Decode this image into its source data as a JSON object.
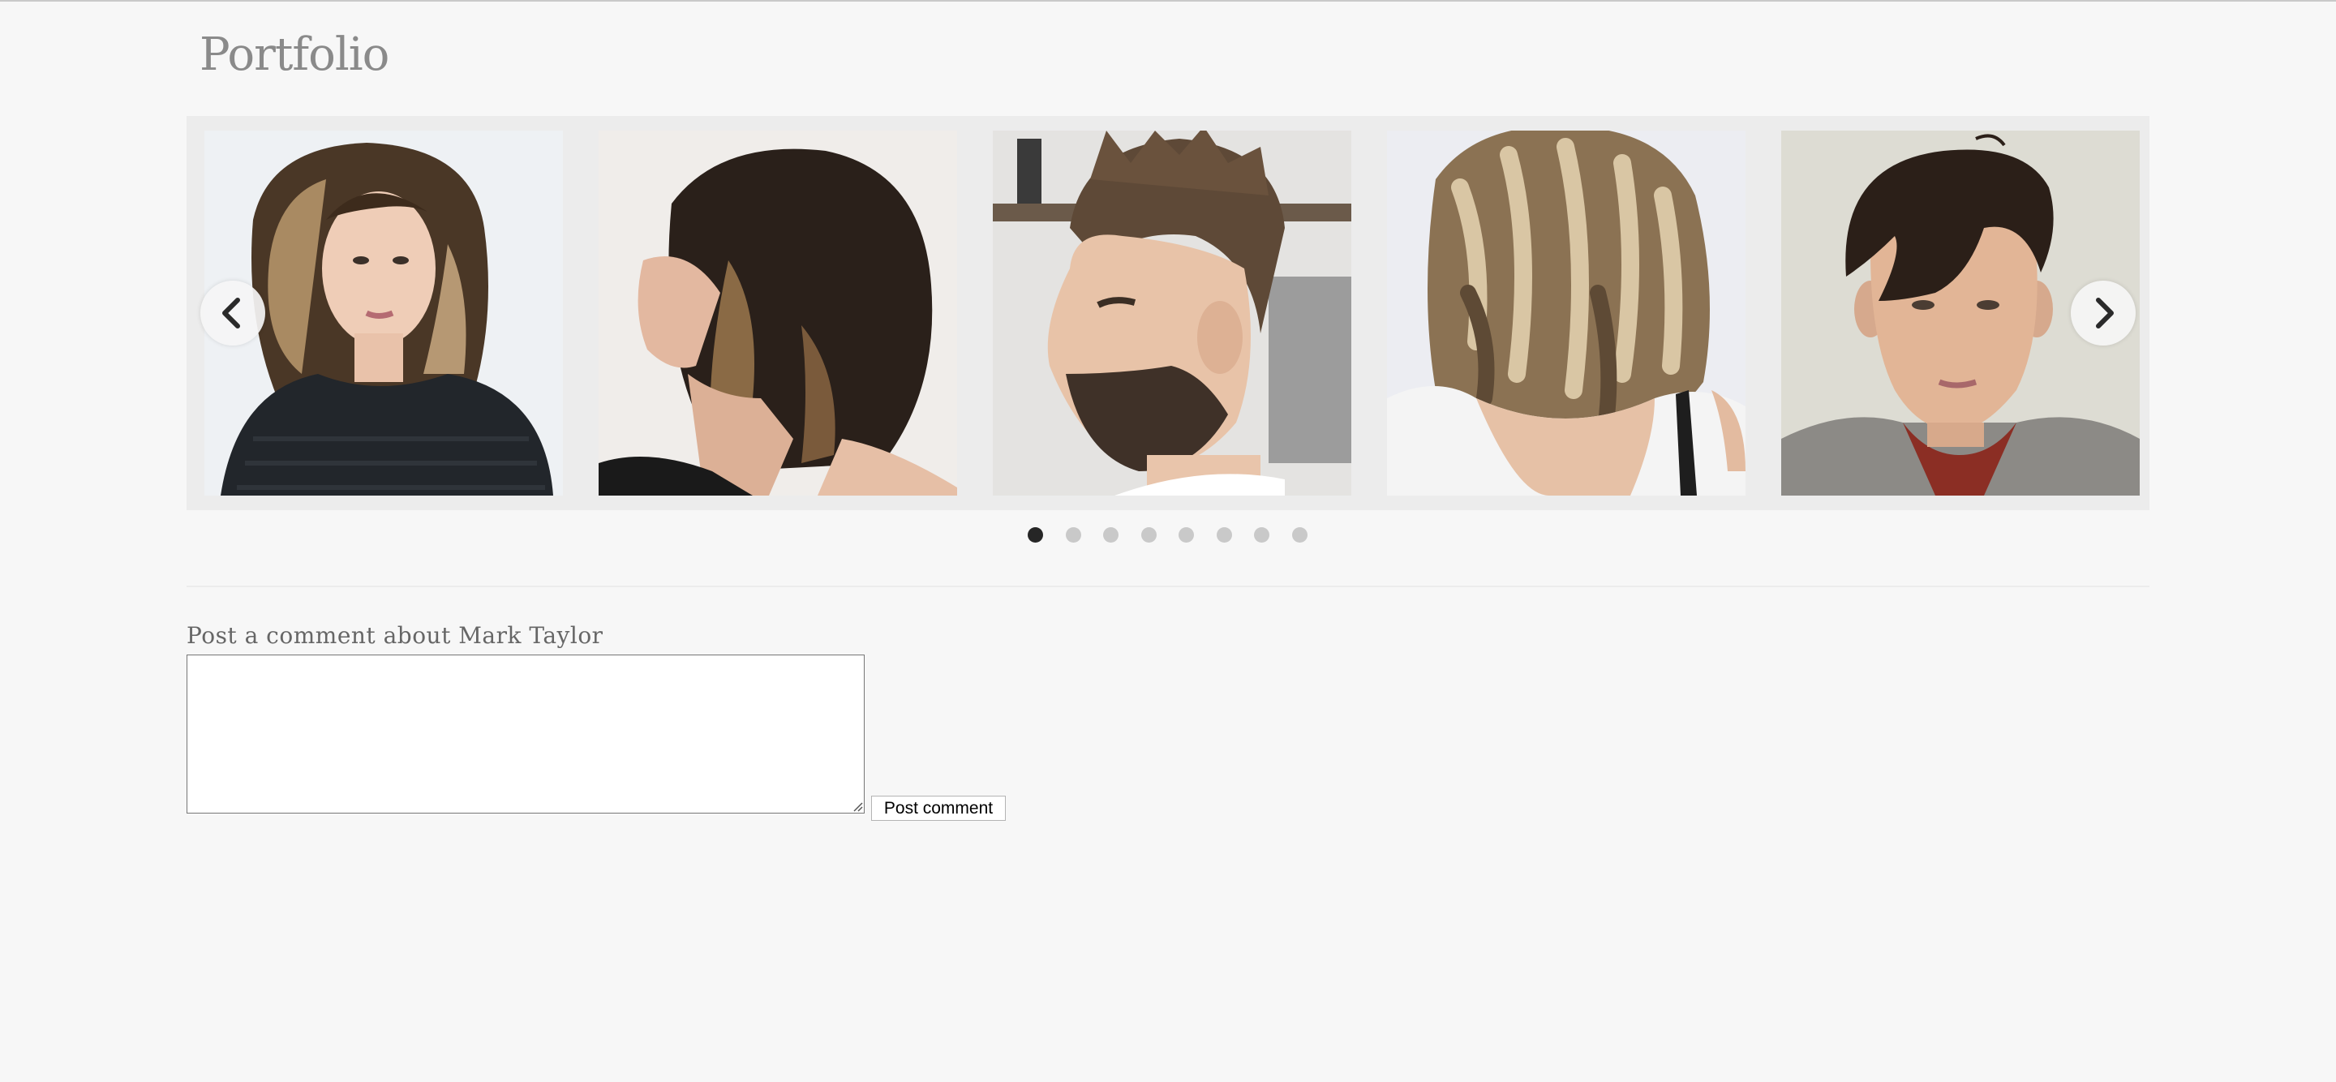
{
  "page": {
    "title": "Portfolio"
  },
  "carousel": {
    "slides": [
      {
        "image": "woman-wavy-highlighted-long-bob"
      },
      {
        "image": "woman-textured-brunette-lob-side-profile"
      },
      {
        "image": "man-textured-quiff-skin-fade-beard"
      },
      {
        "image": "woman-blonde-balayage-waves-back-view"
      },
      {
        "image": "man-dark-fringe-side-swept-cut"
      }
    ],
    "prev_icon": "chevron-left-icon",
    "next_icon": "chevron-right-icon",
    "dot_count": 8,
    "active_dot": 1
  },
  "comment": {
    "label": "Post a comment about Mark Taylor",
    "textarea_value": "",
    "submit_label": "Post comment"
  },
  "colors": {
    "background": "#f7f7f7",
    "carousel_background": "#ececec",
    "dot_active": "#262626",
    "dot_inactive": "#c9c9c9",
    "title": "#8a8a8a"
  }
}
